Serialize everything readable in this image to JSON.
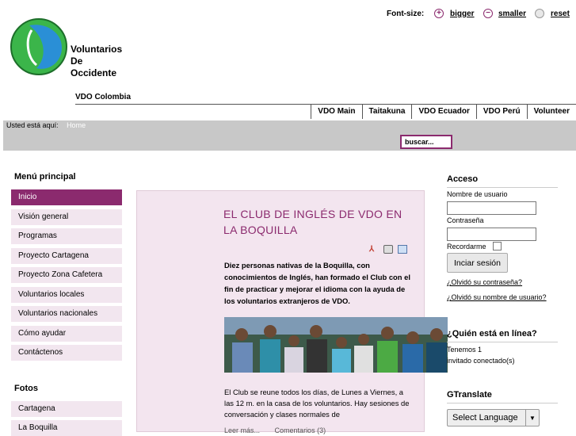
{
  "font_size": {
    "label": "Font-size:",
    "bigger": "bigger",
    "smaller": "smaller",
    "reset": "reset"
  },
  "logo": {
    "line1": "Voluntarios",
    "line2": "De",
    "line3": "Occidente"
  },
  "tagline": "VDO Colombia",
  "nav": [
    "VDO Main",
    "Taitakuna",
    "VDO Ecuador",
    "VDO Perú",
    "Volunteer"
  ],
  "breadcrumb": {
    "label": "Usted está aquí:",
    "home": "Home"
  },
  "search": {
    "value": "buscar..."
  },
  "menu": {
    "heading": "Menú principal",
    "items": [
      "Inicio",
      "Visión general",
      "Programas",
      "Proyecto Cartagena",
      "Proyecto Zona Cafetera",
      "Voluntarios locales",
      "Voluntarios nacionales",
      "Cómo ayudar",
      "Contáctenos"
    ]
  },
  "fotos": {
    "heading": "Fotos",
    "items": [
      "Cartagena",
      "La Boquilla"
    ]
  },
  "article": {
    "title": "EL CLUB DE INGLÉS DE VDO EN LA BOQUILLA",
    "intro": "Diez personas nativas de la Boquilla, con conocimientos de Inglés, han formado el Club con el fin de practicar y mejorar el idioma con la ayuda de los voluntarios extranjeros de VDO.",
    "body": "El Club se reune todos los días, de Lunes a Viernes, a las 12 m. en la casa de los voluntarios. Hay sesiones de conversación y clases normales de",
    "read_more": "Leer más...",
    "comments": "Comentarios (3)"
  },
  "login": {
    "heading": "Acceso",
    "username_label": "Nombre de usuario",
    "password_label": "Contraseña",
    "remember_label": "Recordarme",
    "button": "Inciar sesión",
    "forgot_password": "¿Olvidó su contraseña?",
    "forgot_username": "¿Olvidó su nombre de usuario?"
  },
  "online": {
    "heading": "¿Quién está en línea?",
    "line1": "Tenemos 1",
    "line2": "invitado conectado(s)"
  },
  "gtranslate": {
    "heading": "GTranslate",
    "select": "Select Language"
  },
  "colors": {
    "accent": "#8b2a6e",
    "menu_bg": "#f2e6ef",
    "logo_green": "#3bb54a",
    "logo_blue": "#2a8fd6"
  }
}
